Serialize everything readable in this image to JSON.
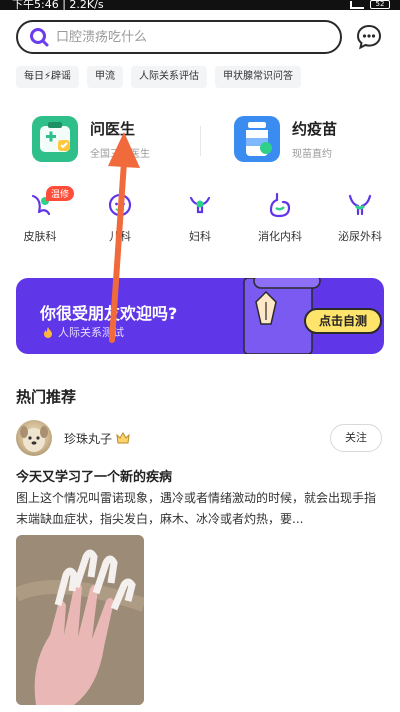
{
  "status_bar": {
    "time": "下午5:46 | 2.2K/s",
    "battery": "52"
  },
  "search": {
    "placeholder": "口腔溃疡吃什么"
  },
  "chips": [
    "每日⚡辟谣",
    "甲流",
    "人际关系评估",
    "甲状腺常识问答"
  ],
  "services": [
    {
      "title": "问医生",
      "subtitle": "全国三甲医生"
    },
    {
      "title": "约疫苗",
      "subtitle": "现苗直约"
    }
  ],
  "departments": [
    {
      "label": "皮肤科",
      "badge": "温修"
    },
    {
      "label": "儿科"
    },
    {
      "label": "妇科"
    },
    {
      "label": "消化内科"
    },
    {
      "label": "泌尿外科"
    }
  ],
  "banner": {
    "title": "你很受朋友欢迎吗?",
    "subtitle": "人际关系测试",
    "button": "点击自测"
  },
  "hot_section": {
    "title": "热门推荐"
  },
  "post": {
    "author": "珍珠丸子",
    "follow": "关注",
    "title": "今天又学习了一个新的疾病",
    "body": "图上这个情况叫雷诺现象，遇冷或者情绪激动的时候，就会出现手指末端缺血症状，指尖发白，麻木、冰冷或者灼热，要..."
  },
  "colors": {
    "accent": "#5f37e8",
    "badge": "#ff4d3a",
    "button_yellow": "#ffe46b",
    "arrow": "#f06a3c"
  }
}
